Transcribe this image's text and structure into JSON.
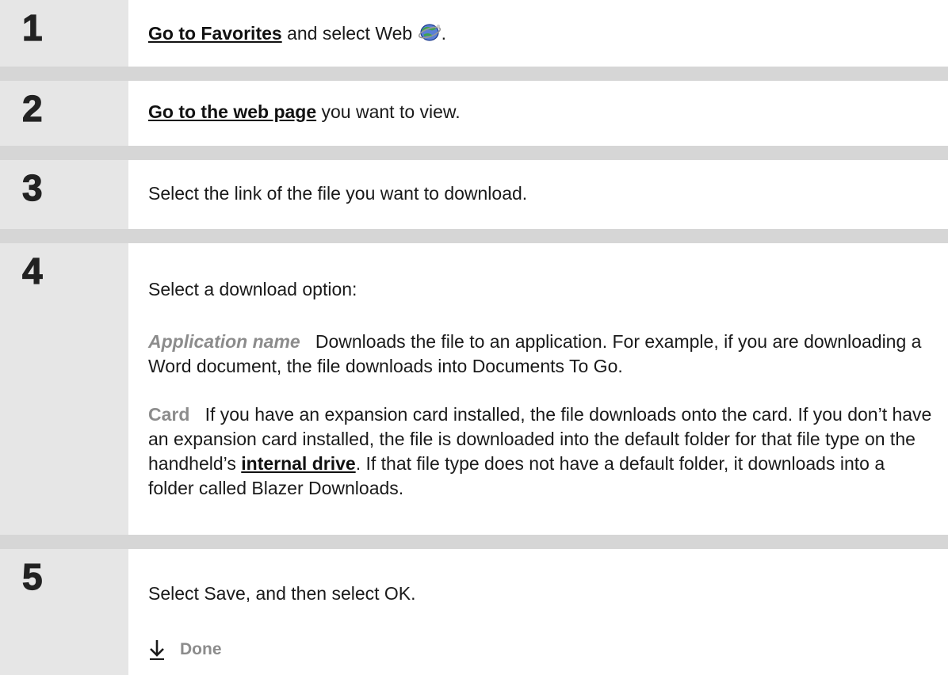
{
  "steps": [
    {
      "number": "1",
      "link": "Go to Favorites",
      "text_after": " and select Web ",
      "icon": "web-browser-icon",
      "text_end": "."
    },
    {
      "number": "2",
      "link": "Go to the web page",
      "text_after": " you want to view."
    },
    {
      "number": "3",
      "text": "Select the link of the file you want to download."
    },
    {
      "number": "4",
      "intro": "Select a download option:",
      "option1_term": "Application name",
      "option1_text": "Downloads the file to an application. For example, if you are downloading a Word document, the file downloads into Documents To Go.",
      "option2_term": "Card",
      "option2_text_before": "If you have an expansion card installed, the file downloads onto the card. If you don’t have an expansion card installed, the file is downloaded into the default folder for that file type on the handheld’s ",
      "option2_link": "internal drive",
      "option2_text_after": ". If that file type does not have a default folder, it downloads into a folder called Blazer Downloads."
    },
    {
      "number": "5",
      "text": "Select Save, and then select OK.",
      "done_label": "Done"
    }
  ],
  "colors": {
    "number_column": "#e6e6e6",
    "separator": "#d6d6d6",
    "term": "#8c8c8c"
  }
}
